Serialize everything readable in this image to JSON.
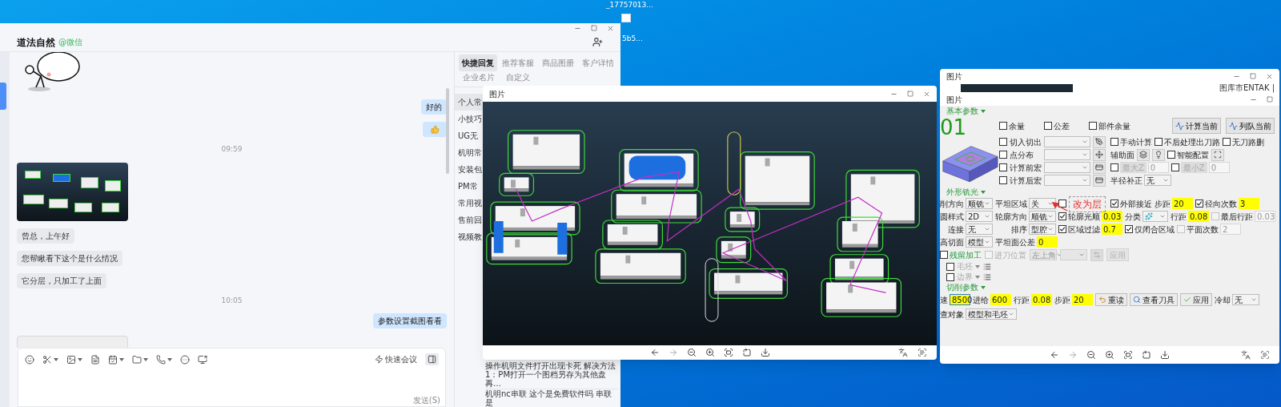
{
  "desktop_icons": [
    {
      "label": "_17757013..."
    },
    {
      "label": "5b5..."
    }
  ],
  "chat_window": {
    "contact_name": "道法自然",
    "contact_source": "@微信",
    "messages": [
      {
        "kind": "sticker",
        "outgoing": false
      },
      {
        "kind": "text",
        "outgoing": true,
        "text": "好的"
      },
      {
        "kind": "thumbs_up",
        "outgoing": true
      },
      {
        "kind": "time",
        "text": "09:59"
      },
      {
        "kind": "image",
        "outgoing": false
      },
      {
        "kind": "text",
        "outgoing": false,
        "text": "曾总，上午好"
      },
      {
        "kind": "text",
        "outgoing": false,
        "text": "您帮瞅看下这个是什么情况"
      },
      {
        "kind": "text",
        "outgoing": false,
        "text": "它分层，只加工了上面"
      },
      {
        "kind": "time",
        "text": "10:05"
      },
      {
        "kind": "text",
        "outgoing": true,
        "text": "参数设置截图看看"
      },
      {
        "kind": "screenshot",
        "outgoing": false
      }
    ],
    "quick_meeting": "快速会议",
    "send_hint": "发送(S)",
    "side_panel": {
      "tabs": [
        {
          "label": "快捷回复",
          "selected": true
        },
        {
          "label": "推荐客服",
          "selected": false
        },
        {
          "label": "商品图册",
          "selected": false
        },
        {
          "label": "客户详情",
          "selected": false
        }
      ],
      "subtabs": [
        {
          "label": "企业名片"
        },
        {
          "label": "自定义"
        }
      ],
      "categories": [
        {
          "label": "个人常",
          "selected": true
        },
        {
          "label": "小技巧",
          "selected": false
        },
        {
          "label": "UG无",
          "selected": false
        },
        {
          "label": "机明常",
          "selected": false
        },
        {
          "label": "安装包",
          "selected": false
        },
        {
          "label": "PM常",
          "selected": false
        },
        {
          "label": "常用视",
          "selected": false
        },
        {
          "label": "售前回",
          "selected": false
        },
        {
          "label": "视频教",
          "selected": false
        }
      ],
      "replies": [
        {
          "text": "操作机明文件打开出现卡死 解决方法1：PM打开一个图档另存为其他盘再…"
        },
        {
          "text": "机明nc串联 这个是免费软件吗 串联是"
        }
      ]
    }
  },
  "image_viewer": {
    "title": "图片"
  },
  "param_viewer": {
    "title": "图片",
    "background_label": "图库市ENTAK |",
    "dialog": {
      "title": "图片",
      "basic": {
        "title": "基本参数",
        "tool_number": "01",
        "checks": [
          {
            "label": "余量",
            "checked": false
          },
          {
            "label": "公差",
            "checked": false
          },
          {
            "label": "部件余量",
            "checked": false
          }
        ],
        "buttons": [
          {
            "label": "计算当前"
          },
          {
            "label": "列队当前"
          }
        ],
        "rows": [
          {
            "macro": {
              "label": "切入切出",
              "checked": false
            },
            "extras": [
              {
                "kind": "check",
                "label": "手动计算",
                "checked": false
              },
              {
                "kind": "check",
                "label": "不后处理出刀路",
                "checked": false
              },
              {
                "kind": "check",
                "label": "无刀路删",
                "checked": false
              }
            ]
          },
          {
            "macro": {
              "label": "点分布",
              "checked": false
            },
            "extras": [
              {
                "kind": "label",
                "text": "辅助面"
              },
              {
                "kind": "icon_button"
              },
              {
                "kind": "icon_button"
              },
              {
                "kind": "check",
                "label": "智能配置",
                "checked": false
              },
              {
                "kind": "icon_button"
              }
            ]
          },
          {
            "macro": {
              "label": "计算前宏",
              "checked": false
            },
            "extras": [
              {
                "kind": "check_limit",
                "label": "最大Z",
                "checked": false,
                "value": "0"
              },
              {
                "kind": "check_limit",
                "label": "最小Z",
                "checked": false,
                "value": "0"
              }
            ]
          },
          {
            "macro": {
              "label": "计算后宏",
              "checked": false
            },
            "extras": [
              {
                "kind": "select",
                "label": "半径补正",
                "value": "无"
              }
            ]
          }
        ]
      },
      "profile": {
        "title": "外形铣光",
        "annotation": "改为层",
        "rows": [
          {
            "fields": [
              {
                "kind": "select",
                "label": "削方向",
                "value": "顺铣"
              },
              {
                "kind": "select",
                "label": "平坦区域",
                "value": "关"
              },
              {
                "kind": "check",
                "checked": false,
                "annotated": true
              },
              {
                "kind": "check",
                "label": "外部接近",
                "checked": true
              },
              {
                "kind": "input",
                "label": "步距",
                "value": "20"
              },
              {
                "kind": "check_input",
                "label": "径向次数",
                "checked": true,
                "value": "3"
              }
            ]
          },
          {
            "fields": [
              {
                "kind": "select",
                "label": "圆样式",
                "value": "2D"
              },
              {
                "kind": "select",
                "label": "轮廓方向",
                "value": "顺铣"
              },
              {
                "kind": "check_input",
                "label": "轮廓光顺",
                "checked": true,
                "value": "0.03"
              },
              {
                "kind": "icon_select",
                "label": "分类"
              },
              {
                "kind": "input",
                "label": "行距",
                "value": "0.08"
              },
              {
                "kind": "check_input",
                "label": "最后行距",
                "checked": false,
                "value": "0.03",
                "disabled": true
              }
            ]
          },
          {
            "fields": [
              {
                "kind": "select",
                "label": "连接",
                "value": "无"
              },
              {
                "kind": "select",
                "label": "排序",
                "value": "型腔"
              },
              {
                "kind": "check_input",
                "label": "区域过滤",
                "checked": true,
                "value": "0.7"
              },
              {
                "kind": "check",
                "label": "仅闭合区域",
                "checked": true
              },
              {
                "kind": "check_input",
                "label": "平面次数",
                "checked": false,
                "value": "2",
                "disabled": true
              }
            ]
          },
          {
            "fields": [
              {
                "kind": "select",
                "label": "高切面",
                "value": "模型"
              },
              {
                "kind": "input",
                "label": "平坦面公差",
                "value": "0"
              }
            ]
          }
        ],
        "options": [
          {
            "kind": "check_accent",
            "label": "残留加工",
            "checked": false
          },
          {
            "kind": "check",
            "label": "进刀位置",
            "checked": false,
            "disabled": true
          },
          {
            "kind": "select",
            "value": "左上角",
            "disabled": true
          },
          {
            "kind": "select",
            "disabled": true
          },
          {
            "kind": "icon_button",
            "disabled": true
          },
          {
            "kind": "button",
            "label": "应用",
            "disabled": true
          }
        ],
        "toggles": [
          {
            "kind": "list_toggle",
            "label": "毛坯",
            "checked": false
          },
          {
            "kind": "list_toggle",
            "label": "边界",
            "checked": false
          }
        ]
      },
      "cutting": {
        "title": "切削参数",
        "rows": [
          {
            "fields": [
              {
                "kind": "input",
                "label": "速",
                "value": "8500",
                "focused": true
              },
              {
                "kind": "input",
                "label": "进给",
                "value": "600"
              },
              {
                "kind": "input",
                "label": "行距",
                "value": "0.08"
              },
              {
                "kind": "input",
                "label": "步距",
                "value": "20"
              },
              {
                "kind": "button",
                "label": "重读"
              },
              {
                "kind": "button",
                "label": "查看刀具"
              },
              {
                "kind": "button",
                "label": "应用"
              },
              {
                "kind": "select",
                "label": "冷却",
                "value": "无"
              }
            ]
          },
          {
            "fields": [
              {
                "kind": "select",
                "label": "查对象",
                "value": "模型和毛坯"
              }
            ]
          }
        ]
      }
    }
  }
}
